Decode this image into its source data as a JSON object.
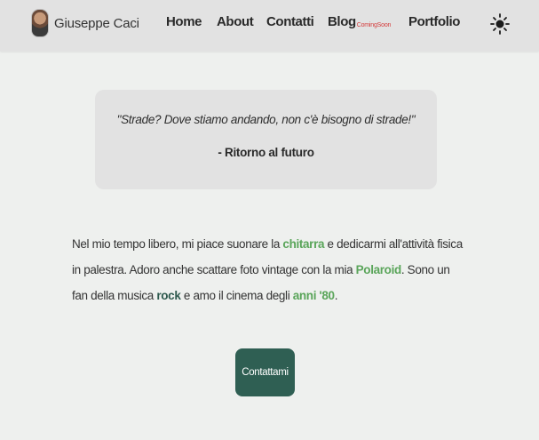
{
  "nav": {
    "brand_name": "Giuseppe Caci",
    "links": {
      "home": "Home",
      "about": "About",
      "contatti": "Contatti",
      "blog": "Blog",
      "blog_badge": "ComingSoon",
      "portfolio": "Portfolio"
    },
    "theme_icon": "sun-icon"
  },
  "quote": {
    "text": "\"Strade? Dove stiamo andando, non c'è bisogno di strade!\"",
    "author": "- Ritorno al futuro"
  },
  "bio": {
    "part1": "Nel mio tempo libero, mi piace suonare la ",
    "guitar": "chitarra",
    "part2": " e dedicarmi all'attività fisica in palestra. Adoro anche scattare foto vintage con la mia ",
    "polaroid": "Polaroid",
    "part3": ". Sono un fan della musica ",
    "rock": "rock",
    "part4": " e amo il cinema degli ",
    "eighties": "anni '80",
    "part5": "."
  },
  "cta": {
    "label": "Contattami"
  },
  "colors": {
    "accent_green": "#5aa55a",
    "button_bg": "#2f5f53",
    "badge_red": "#d43b3b"
  }
}
